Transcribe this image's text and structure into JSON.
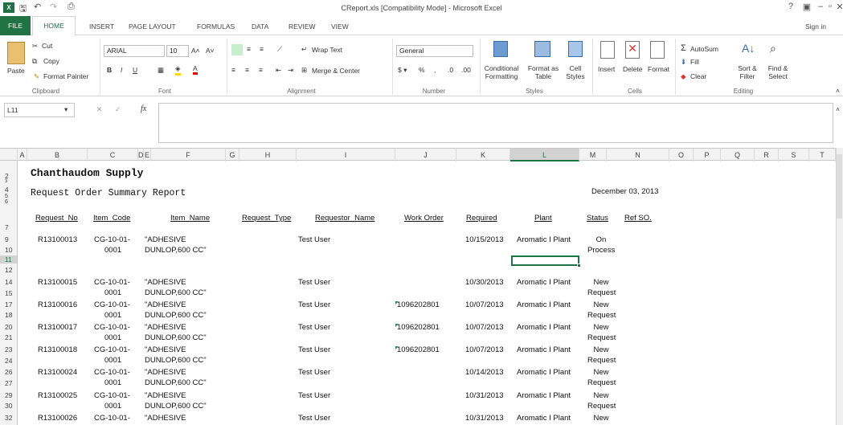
{
  "window": {
    "title": "CReport.xls  [Compatibility Mode] - Microsoft Excel",
    "sign_in": "Sign in",
    "help": "?"
  },
  "tabs": [
    "FILE",
    "HOME",
    "INSERT",
    "PAGE LAYOUT",
    "FORMULAS",
    "DATA",
    "REVIEW",
    "VIEW"
  ],
  "ribbon": {
    "clipboard": {
      "paste": "Paste",
      "cut": "Cut",
      "copy": "Copy",
      "format_painter": "Format Painter",
      "label": "Clipboard"
    },
    "font": {
      "name": "ARIAL",
      "size": "10",
      "label": "Font"
    },
    "alignment": {
      "wrap": "Wrap Text",
      "merge": "Merge & Center",
      "label": "Alignment"
    },
    "number": {
      "format": "General",
      "label": "Number"
    },
    "styles": {
      "conditional": "Conditional Formatting",
      "format_table": "Format as Table",
      "cell_styles": "Cell Styles",
      "label": "Styles"
    },
    "cells": {
      "insert": "Insert",
      "delete": "Delete",
      "format": "Format",
      "label": "Cells"
    },
    "editing": {
      "autosum": "AutoSum",
      "fill": "Fill",
      "clear": "Clear",
      "sort": "Sort & Filter",
      "find": "Find & Select",
      "label": "Editing"
    }
  },
  "formula_bar": {
    "name_box": "L11",
    "fx": "fx",
    "value": ""
  },
  "columns": [
    "A",
    "B",
    "C",
    "D",
    "E",
    "F",
    "G",
    "H",
    "I",
    "J",
    "K",
    "L",
    "M",
    "N",
    "O",
    "P",
    "Q",
    "R",
    "S",
    "T"
  ],
  "report": {
    "company": "Chanthaudom Supply",
    "title": "Request Order Summary Report",
    "date": "December 03, 2013",
    "headers": [
      "Request_No",
      "Item_Code",
      "Item_Name",
      "Request_Type",
      "Requestor_Name",
      "Work Order",
      "Required",
      "Plant",
      "Status",
      "Ref SO."
    ]
  },
  "row_numbers": [
    "2",
    "3",
    "4",
    "5",
    "6",
    "7",
    "9",
    "10",
    "11",
    "12",
    "14",
    "15",
    "17",
    "18",
    "20",
    "21",
    "23",
    "24",
    "26",
    "27",
    "29",
    "30",
    "32"
  ],
  "records": [
    {
      "req": "R13100013",
      "code1": "CG-10-01-",
      "code2": "0001",
      "name1": "\"ADHESIVE",
      "name2": "DUNLOP,600 CC\"",
      "requestor": "Test User",
      "wo": "",
      "required": "10/15/2013",
      "plant": "Aromatic I Plant",
      "status1": "On",
      "status2": "Process"
    },
    {
      "req": "R13100015",
      "code1": "CG-10-01-",
      "code2": "0001",
      "name1": "\"ADHESIVE",
      "name2": "DUNLOP,600 CC\"",
      "requestor": "Test User",
      "wo": "",
      "required": "10/30/2013",
      "plant": "Aromatic I Plant",
      "status1": "New",
      "status2": "Request"
    },
    {
      "req": "R13100016",
      "code1": "CG-10-01-",
      "code2": "0001",
      "name1": "\"ADHESIVE",
      "name2": "DUNLOP,600 CC\"",
      "requestor": "Test User",
      "wo": "1096202801",
      "required": "10/07/2013",
      "plant": "Aromatic I Plant",
      "status1": "New",
      "status2": "Request"
    },
    {
      "req": "R13100017",
      "code1": "CG-10-01-",
      "code2": "0001",
      "name1": "\"ADHESIVE",
      "name2": "DUNLOP,600 CC\"",
      "requestor": "Test User",
      "wo": "1096202801",
      "required": "10/07/2013",
      "plant": "Aromatic I Plant",
      "status1": "New",
      "status2": "Request"
    },
    {
      "req": "R13100018",
      "code1": "CG-10-01-",
      "code2": "0001",
      "name1": "\"ADHESIVE",
      "name2": "DUNLOP,600 CC\"",
      "requestor": "Test User",
      "wo": "1096202801",
      "required": "10/07/2013",
      "plant": "Aromatic I Plant",
      "status1": "New",
      "status2": "Request"
    },
    {
      "req": "R13100024",
      "code1": "CG-10-01-",
      "code2": "0001",
      "name1": "\"ADHESIVE",
      "name2": "DUNLOP,600 CC\"",
      "requestor": "Test User",
      "wo": "",
      "required": "10/14/2013",
      "plant": "Aromatic I Plant",
      "status1": "New",
      "status2": "Request"
    },
    {
      "req": "R13100025",
      "code1": "CG-10-01-",
      "code2": "0001",
      "name1": "\"ADHESIVE",
      "name2": "DUNLOP,600 CC\"",
      "requestor": "Test User",
      "wo": "",
      "required": "10/31/2013",
      "plant": "Aromatic I Plant",
      "status1": "New",
      "status2": "Request"
    },
    {
      "req": "R13100026",
      "code1": "CG-10-01-",
      "code2": "",
      "name1": "\"ADHESIVE",
      "name2": "",
      "requestor": "Test User",
      "wo": "",
      "required": "10/31/2013",
      "plant": "Aromatic I Plant",
      "status1": "New",
      "status2": ""
    }
  ],
  "colors": {
    "excel_green": "#217346",
    "selected_cell": "#217346",
    "header_bg": "#f3f3f3"
  }
}
